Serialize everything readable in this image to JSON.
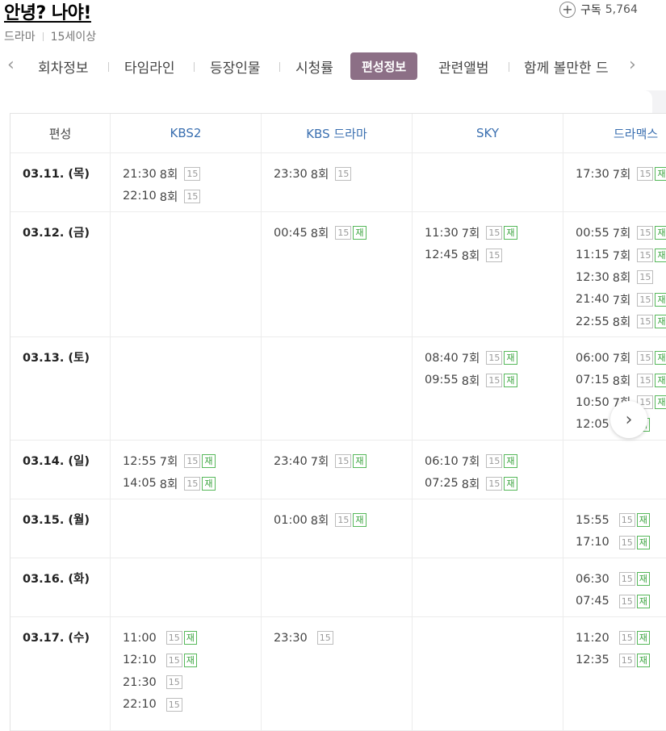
{
  "header": {
    "title": "안녕? 나야!",
    "subscribe_label": "구독",
    "subscribe_count": "5,764",
    "genre": "드라마",
    "rating": "15세이상"
  },
  "tabs": [
    "회차정보",
    "타임라인",
    "등장인물",
    "시청률",
    "편성정보",
    "관련앨범",
    "함께 볼만한 드"
  ],
  "active_tab": "편성정보",
  "badges": {
    "age": "15",
    "rerun": "재"
  },
  "table": {
    "columns": [
      "편성",
      "KBS2",
      "KBS 드라마",
      "SKY",
      "드라맥스"
    ],
    "rows": [
      {
        "date": "03.11. (목)",
        "cells": [
          [
            [
              "21:30",
              "8회",
              false
            ],
            [
              "22:10",
              "8회",
              false
            ]
          ],
          [
            [
              "23:30",
              "8회",
              false
            ]
          ],
          [],
          [
            [
              "17:30",
              "7회",
              true
            ]
          ]
        ]
      },
      {
        "date": "03.12. (금)",
        "cells": [
          [],
          [
            [
              "00:45",
              "8회",
              true
            ]
          ],
          [
            [
              "11:30",
              "7회",
              true
            ],
            [
              "12:45",
              "8회",
              false
            ]
          ],
          [
            [
              "00:55",
              "7회",
              true
            ],
            [
              "11:15",
              "7회",
              true
            ],
            [
              "12:30",
              "8회",
              false
            ],
            [
              "21:40",
              "7회",
              true
            ],
            [
              "22:55",
              "8회",
              true
            ]
          ]
        ]
      },
      {
        "date": "03.13. (토)",
        "cells": [
          [],
          [],
          [
            [
              "08:40",
              "7회",
              true
            ],
            [
              "09:55",
              "8회",
              true
            ]
          ],
          [
            [
              "06:00",
              "7회",
              true
            ],
            [
              "07:15",
              "8회",
              true
            ],
            [
              "10:50",
              "7회",
              true
            ],
            [
              "12:05",
              "",
              true
            ]
          ]
        ]
      },
      {
        "date": "03.14. (일)",
        "cells": [
          [
            [
              "12:55",
              "7회",
              true
            ],
            [
              "14:05",
              "8회",
              true
            ]
          ],
          [
            [
              "23:40",
              "7회",
              true
            ]
          ],
          [
            [
              "06:10",
              "7회",
              true
            ],
            [
              "07:25",
              "8회",
              true
            ]
          ],
          []
        ]
      },
      {
        "date": "03.15. (월)",
        "cells": [
          [],
          [
            [
              "01:00",
              "8회",
              true
            ]
          ],
          [],
          [
            [
              "15:55",
              "",
              true
            ],
            [
              "17:10",
              "",
              true
            ]
          ]
        ]
      },
      {
        "date": "03.16. (화)",
        "cells": [
          [],
          [],
          [],
          [
            [
              "06:30",
              "",
              true
            ],
            [
              "07:45",
              "",
              true
            ]
          ]
        ]
      },
      {
        "date": "03.17. (수)",
        "cells": [
          [
            [
              "11:00",
              "",
              true
            ],
            [
              "12:10",
              "",
              true
            ],
            [
              "21:30",
              "",
              false
            ],
            [
              "22:10",
              "",
              false
            ]
          ],
          [
            [
              "23:30",
              "",
              false
            ]
          ],
          [],
          [
            [
              "11:20",
              "",
              true
            ],
            [
              "12:35",
              "",
              true
            ]
          ]
        ]
      }
    ]
  }
}
